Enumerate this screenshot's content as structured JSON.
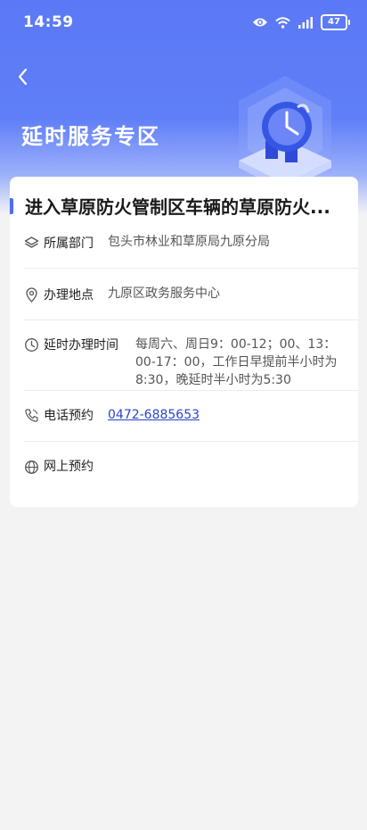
{
  "status_bar": {
    "time": "14:59",
    "battery": "47"
  },
  "header": {
    "title": "延时服务专区"
  },
  "card": {
    "title": "进入草原防火管制区车辆的草原防火...",
    "rows": [
      {
        "label": "所属部门",
        "value": "包头市林业和草原局九原分局"
      },
      {
        "label": "办理地点",
        "value": "九原区政务服务中心"
      },
      {
        "label": "延时办理时间",
        "value": "每周六、周日9：00-12；00、13：00-17：00，工作日早提前半小时为8:30，晚延时半小时为5:30"
      },
      {
        "label": "电话预约",
        "value": "0472-6885653"
      },
      {
        "label": "网上预约",
        "value": ""
      }
    ]
  },
  "colors": {
    "header_blue": "#5b79f6",
    "accent": "#4f6ef2",
    "link": "#2a44c9"
  }
}
